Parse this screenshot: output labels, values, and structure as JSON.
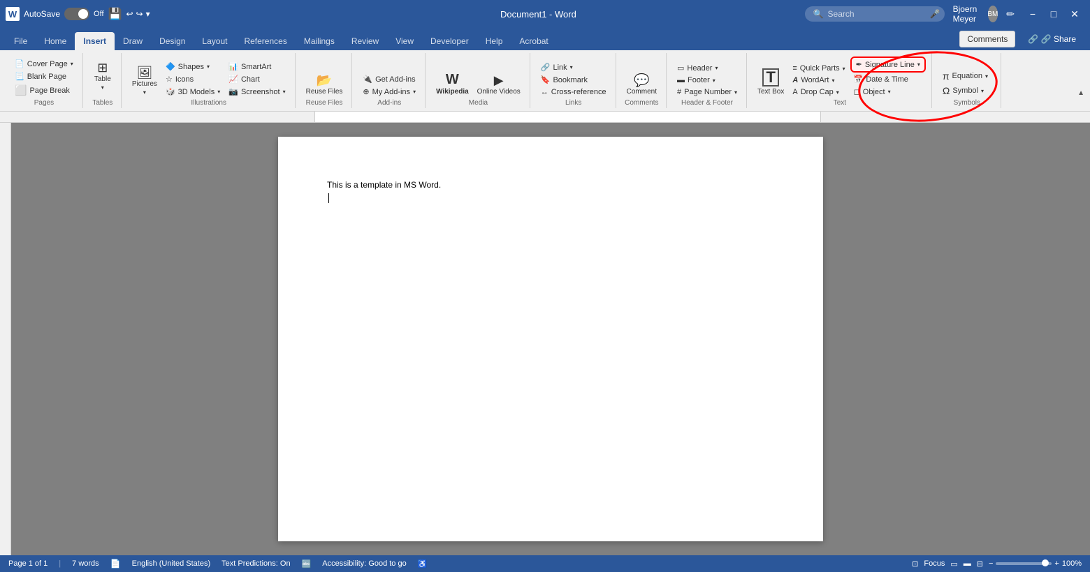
{
  "titlebar": {
    "logo": "W",
    "autosave_label": "AutoSave",
    "autosave_state": "Off",
    "doc_title": "Document1 - Word",
    "search_placeholder": "Search",
    "user_name": "Bjoern Meyer",
    "minimize": "−",
    "maximize": "□",
    "close": "✕"
  },
  "ribbon_tabs": [
    {
      "id": "file",
      "label": "File"
    },
    {
      "id": "home",
      "label": "Home"
    },
    {
      "id": "insert",
      "label": "Insert",
      "active": true
    },
    {
      "id": "draw",
      "label": "Draw"
    },
    {
      "id": "design",
      "label": "Design"
    },
    {
      "id": "layout",
      "label": "Layout"
    },
    {
      "id": "references",
      "label": "References"
    },
    {
      "id": "mailings",
      "label": "Mailings"
    },
    {
      "id": "review",
      "label": "Review"
    },
    {
      "id": "view",
      "label": "View"
    },
    {
      "id": "developer",
      "label": "Developer"
    },
    {
      "id": "help",
      "label": "Help"
    },
    {
      "id": "acrobat",
      "label": "Acrobat"
    }
  ],
  "ribbon_groups": {
    "pages": {
      "label": "Pages",
      "items": [
        {
          "id": "cover-page",
          "label": "Cover Page",
          "icon": "📄",
          "has_arrow": true
        },
        {
          "id": "blank-page",
          "label": "Blank Page",
          "icon": "📃"
        },
        {
          "id": "page-break",
          "label": "Page Break",
          "icon": "⬜"
        }
      ]
    },
    "tables": {
      "label": "Tables",
      "items": [
        {
          "id": "table",
          "label": "Table",
          "icon": "⊞",
          "has_arrow": true
        }
      ]
    },
    "illustrations": {
      "label": "Illustrations",
      "items": [
        {
          "id": "pictures",
          "label": "Pictures",
          "icon": "🖼",
          "has_arrow": true
        },
        {
          "id": "shapes",
          "label": "Shapes",
          "icon": "🔷",
          "has_arrow": true
        },
        {
          "id": "icons",
          "label": "Icons",
          "icon": "☆"
        },
        {
          "id": "3d-models",
          "label": "3D Models",
          "icon": "🎲",
          "has_arrow": true
        },
        {
          "id": "smartart",
          "label": "SmartArt",
          "icon": "📊"
        },
        {
          "id": "chart",
          "label": "Chart",
          "icon": "📈"
        },
        {
          "id": "screenshot",
          "label": "Screenshot",
          "icon": "📷",
          "has_arrow": true
        }
      ]
    },
    "reuse_files": {
      "label": "Reuse Files",
      "items": [
        {
          "id": "reuse-files",
          "label": "Reuse Files",
          "icon": "📂"
        }
      ]
    },
    "add_ins": {
      "label": "Add-ins",
      "items": [
        {
          "id": "get-add-ins",
          "label": "Get Add-ins",
          "icon": "🔌"
        },
        {
          "id": "my-add-ins",
          "label": "My Add-ins",
          "icon": "⊕",
          "has_arrow": true
        }
      ]
    },
    "media": {
      "label": "Media",
      "items": [
        {
          "id": "wikipedia",
          "label": "Wikipedia",
          "icon": "W"
        },
        {
          "id": "online-videos",
          "label": "Online Videos",
          "icon": "▶"
        }
      ]
    },
    "links": {
      "label": "Links",
      "items": [
        {
          "id": "link",
          "label": "Link",
          "icon": "🔗",
          "has_arrow": true
        },
        {
          "id": "bookmark",
          "label": "Bookmark",
          "icon": "🔖"
        },
        {
          "id": "cross-reference",
          "label": "Cross-reference",
          "icon": "↔"
        }
      ]
    },
    "comments": {
      "label": "Comments",
      "items": [
        {
          "id": "comment",
          "label": "Comment",
          "icon": "💬"
        }
      ]
    },
    "header_footer": {
      "label": "Header & Footer",
      "items": [
        {
          "id": "header",
          "label": "Header",
          "icon": "▭",
          "has_arrow": true
        },
        {
          "id": "footer",
          "label": "Footer",
          "icon": "▬",
          "has_arrow": true
        },
        {
          "id": "page-number",
          "label": "Page Number",
          "icon": "#",
          "has_arrow": true
        }
      ]
    },
    "text": {
      "label": "Text",
      "items": [
        {
          "id": "text-box",
          "label": "Text Box",
          "icon": "T"
        },
        {
          "id": "quick-parts",
          "label": "Quick Parts",
          "icon": "≡",
          "has_arrow": true
        },
        {
          "id": "wordart",
          "label": "WordArt",
          "icon": "A",
          "has_arrow": true
        },
        {
          "id": "drop-cap",
          "label": "Drop Cap",
          "icon": "A",
          "has_arrow": true
        },
        {
          "id": "signature-line",
          "label": "Signature Line",
          "icon": "✒",
          "has_arrow": true,
          "highlighted": true
        },
        {
          "id": "date-time",
          "label": "Date & Time",
          "icon": "📅"
        },
        {
          "id": "object",
          "label": "Object",
          "icon": "◻",
          "has_arrow": true
        }
      ]
    },
    "symbols": {
      "label": "Symbols",
      "items": [
        {
          "id": "equation",
          "label": "Equation",
          "icon": "π",
          "has_arrow": true
        },
        {
          "id": "symbol",
          "label": "Symbol",
          "icon": "Ω",
          "has_arrow": true
        }
      ]
    }
  },
  "action_buttons": {
    "comments_label": "Comments",
    "share_label": "🔗 Share"
  },
  "document": {
    "content_line1": "This is a template in MS Word.",
    "cursor_visible": true
  },
  "status_bar": {
    "page": "Page 1 of 1",
    "words": "7 words",
    "language": "English (United States)",
    "text_predictions": "Text Predictions: On",
    "accessibility": "Accessibility: Good to go",
    "focus_label": "Focus",
    "zoom_percent": "100%"
  }
}
